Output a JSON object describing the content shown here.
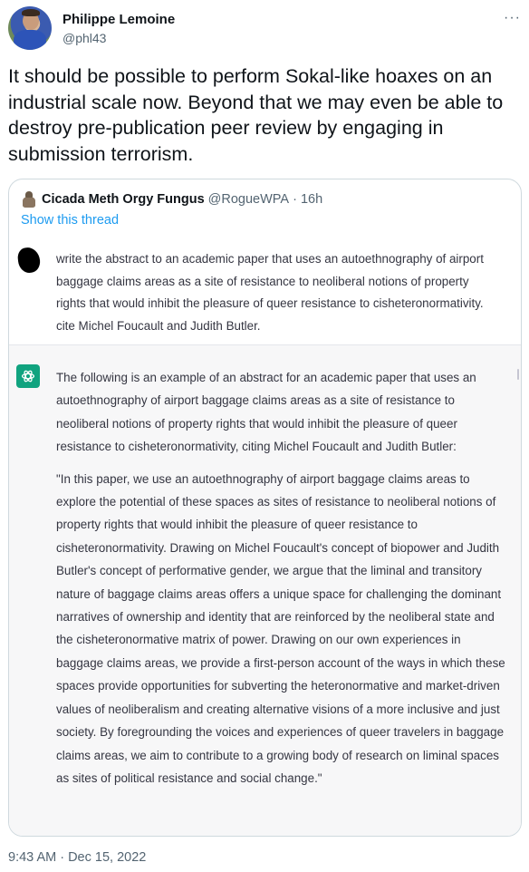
{
  "author": {
    "name": "Philippe Lemoine",
    "handle": "@phl43",
    "more_label": "···"
  },
  "tweet": {
    "text": "It should be possible to perform Sokal-like hoaxes on an industrial scale now. Beyond that we may even be able to destroy pre-publication peer review by engaging in submission terrorism.",
    "timestamp": "9:43 AM · Dec 15, 2022"
  },
  "quoted": {
    "name": "Cicada Meth Orgy Fungus",
    "handle": "@RogueWPA",
    "time": "· 16h",
    "show_thread": "Show this thread",
    "prompt": "write the abstract to an academic paper that uses an autoethnography of airport baggage claims areas as a site of resistance to neoliberal notions of property rights that would inhibit the pleasure of queer resistance to cisheteronormativity. cite Michel Foucault and Judith Butler.",
    "answer_intro": "The following is an example of an abstract for an academic paper that uses an autoethnography of airport baggage claims areas as a site of resistance to neoliberal notions of property rights that would inhibit the pleasure of queer resistance to cisheteronormativity, citing Michel Foucault and Judith Butler:",
    "answer_body": "\"In this paper, we use an autoethnography of airport baggage claims areas to explore the potential of these spaces as sites of resistance to neoliberal notions of property rights that would inhibit the pleasure of queer resistance to cisheteronormativity. Drawing on Michel Foucault's concept of biopower and Judith Butler's concept of performative gender, we argue that the liminal and transitory nature of baggage claims areas offers a unique space for challenging the dominant narratives of ownership and identity that are reinforced by the neoliberal state and the cisheteronormative matrix of power. Drawing on our own experiences in baggage claims areas, we provide a first-person account of the ways in which these spaces provide opportunities for subverting the heteronormative and market-driven values of neoliberalism and creating alternative visions of a more inclusive and just society. By foregrounding the voices and experiences of queer travelers in baggage claims areas, we aim to contribute to a growing body of research on liminal spaces as sites of political resistance and social change.\""
  },
  "icons": {
    "author_avatar": "avatar",
    "quoted_avatar": "avatar",
    "redaction": "redacted-avatar",
    "assistant_logo": "openai-logo-icon",
    "more": "more-icon"
  },
  "colors": {
    "link": "#1d9bf0",
    "secondary_text": "#536471",
    "assistant_green": "#10a37f",
    "answer_background": "#f7f7f8"
  }
}
